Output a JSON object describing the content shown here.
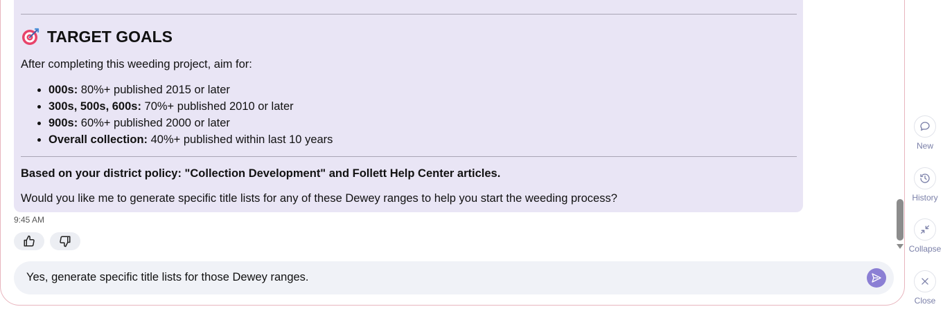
{
  "message": {
    "heading_emoji": "target-icon",
    "heading": "TARGET GOALS",
    "intro": "After completing this weeding project, aim for:",
    "goals": [
      {
        "label": "000s:",
        "text": " 80%+ published 2015 or later"
      },
      {
        "label": "300s, 500s, 600s:",
        "text": " 70%+ published 2010 or later"
      },
      {
        "label": "900s:",
        "text": " 60%+ published 2000 or later"
      },
      {
        "label": "Overall collection:",
        "text": " 40%+ published within last 10 years"
      }
    ],
    "source": "Based on your district policy: \"Collection Development\" and Follett Help Center articles.",
    "question": "Would you like me to generate specific title lists for any of these Dewey ranges to help you start the weeding process?",
    "timestamp": "9:45 AM"
  },
  "feedback": {
    "thumbs_up_icon": "thumbs-up-icon",
    "thumbs_down_icon": "thumbs-down-icon"
  },
  "composer": {
    "value": "Yes, generate specific title lists for those Dewey ranges.",
    "send_icon": "send-icon"
  },
  "sidebar": {
    "items": [
      {
        "label": "New",
        "icon": "chat-bubble-icon"
      },
      {
        "label": "History",
        "icon": "history-icon"
      },
      {
        "label": "Collapse",
        "icon": "collapse-icon"
      },
      {
        "label": "Close",
        "icon": "close-icon"
      }
    ]
  },
  "colors": {
    "bubble": "#e9e5f5",
    "accent": "#8b7fd4",
    "frame_border": "#e8b4bd",
    "sidebar_label": "#7a7fa8"
  }
}
